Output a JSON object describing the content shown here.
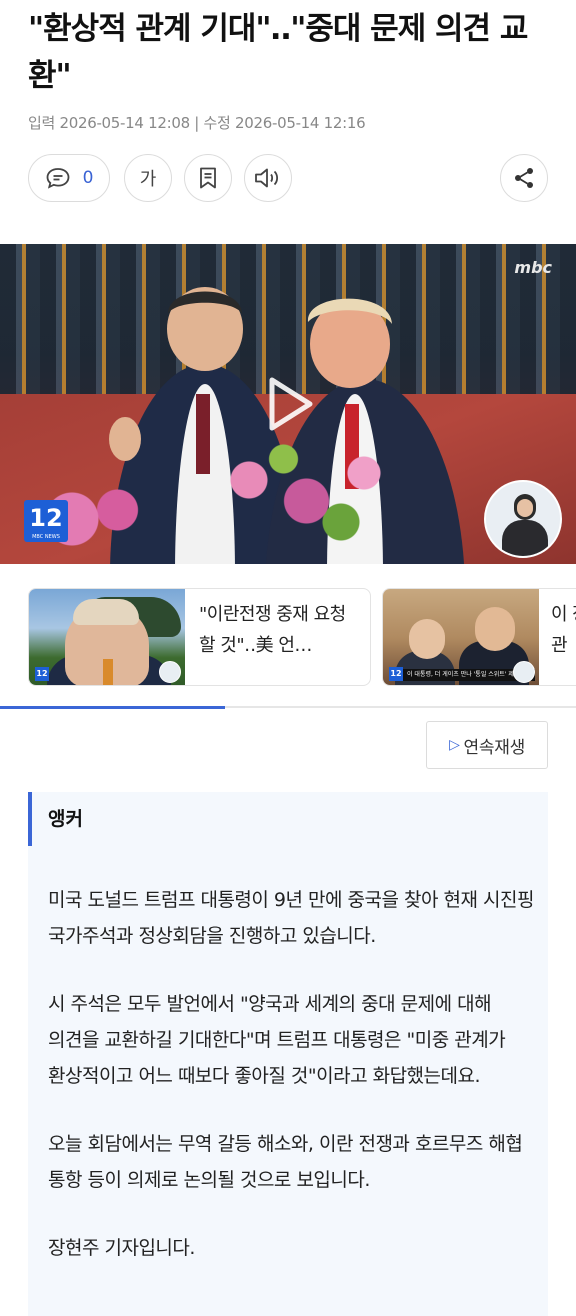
{
  "article": {
    "headline": "\"환상적 관계 기대\"‥\"중대 문제 의견 교환\"",
    "meta": "입력 2026-05-14 12:08 | 수정 2026-05-14 12:16"
  },
  "toolbar": {
    "comment_count": "0",
    "font_label": "가",
    "icons": [
      "comment-icon",
      "bookmark-icon",
      "speaker-icon",
      "share-icon"
    ]
  },
  "video": {
    "broadcaster": "mbc",
    "channel_number": "12",
    "channel_sub": "MBC NEWS"
  },
  "related": [
    {
      "title": "\"이란전쟁 중재 요청할 것\"‥美 언…",
      "channel": "12"
    },
    {
      "title": "이 장관",
      "channel": "12",
      "caption": "이 대통령, 더 게이츠 만나 '통일 스위트' 제안"
    }
  ],
  "related_progress": 0.39,
  "autoplay_label": "연속재생",
  "body": {
    "section_label": "앵커",
    "paragraphs": [
      "미국 도널드 트럼프 대통령이 9년 만에 중국을 찾아 현재 시진핑 국가주석과 정상회담을 진행하고 있습니다.",
      "시 주석은 모두 발언에서 \"양국과 세계의 중대 문제에 대해 의견을 교환하길 기대한다\"며 트럼프 대통령은 \"미중 관계가 환상적이고 어느 때보다 좋아질 것\"이라고 화답했는데요.",
      "오늘 회담에서는 무역 갈등 해소와, 이란 전쟁과 호르무즈 해협 통항 등이 의제로 논의될 것으로 보입니다.",
      "장현주 기자입니다."
    ]
  },
  "colors": {
    "accent": "#3b66d6",
    "panel_bg": "#f4f8fd"
  }
}
